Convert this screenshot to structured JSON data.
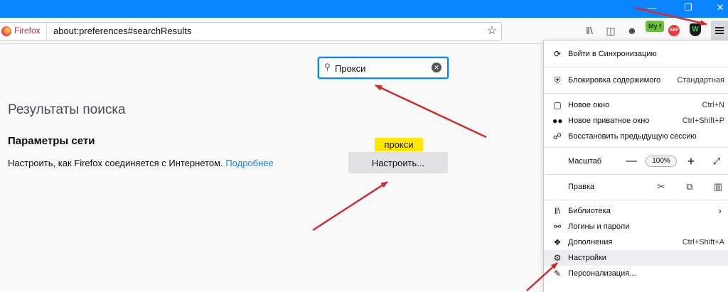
{
  "window": {
    "minimize_icon": "minimize-icon",
    "maximize_icon": "restore-icon",
    "close_icon": "close-icon",
    "titlebar_color": "#0a84ff"
  },
  "urlbar": {
    "browser_label": "Firefox",
    "url": "about:preferences#searchResults"
  },
  "content": {
    "search_value": "Прокси",
    "results_title": "Результаты поиска",
    "section_title": "Параметры сети",
    "section_desc": "Настроить, как Firefox соединяется с Интернетом.",
    "learn_more": "Подробнее",
    "highlight": "прокси",
    "settings_button": "Настроить..."
  },
  "extensions": {
    "myf": "My f",
    "abp": "ABP",
    "shield": "W"
  },
  "menu": {
    "sync": "Войти в Синхронизацию",
    "content_blocking": "Блокировка содержимого",
    "content_blocking_value": "Стандартная",
    "new_window": "Новое окно",
    "new_window_shortcut": "Ctrl+N",
    "private_window": "Новое приватное окно",
    "private_window_shortcut": "Ctrl+Shift+P",
    "restore_session": "Восстановить предыдущую сессию",
    "zoom_label": "Масштаб",
    "zoom_minus": "—",
    "zoom_value": "100%",
    "zoom_plus": "+",
    "edit_label": "Правка",
    "library": "Библиотека",
    "logins": "Логины и пароли",
    "addons": "Дополнения",
    "addons_shortcut": "Ctrl+Shift+A",
    "settings": "Настройки",
    "customize": "Персонализация..."
  },
  "colors": {
    "accent": "#0a84ff",
    "arrow": "#d12c2c",
    "highlight": "#ffe900"
  }
}
